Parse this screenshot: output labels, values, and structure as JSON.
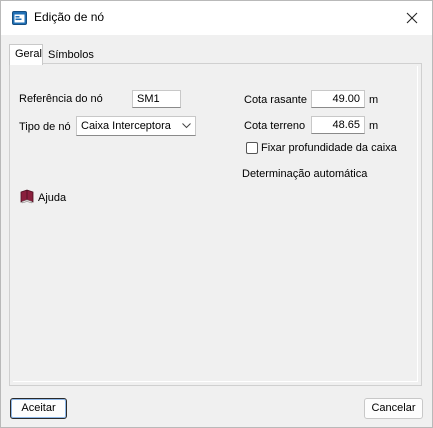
{
  "window": {
    "title": "Edição de nó",
    "icon": "window-app-icon",
    "close_icon": "close-icon"
  },
  "tabs": [
    {
      "label": "Geral",
      "active": true
    },
    {
      "label": "Símbolos",
      "active": false
    }
  ],
  "form": {
    "ref_label": "Referência do nó",
    "ref_value": "SM1",
    "type_label": "Tipo de nó",
    "type_value": "Caixa Interceptora",
    "cota_rasante_label": "Cota rasante",
    "cota_rasante_value": "49.00",
    "cota_rasante_unit": "m",
    "cota_terreno_label": "Cota terreno",
    "cota_terreno_value": "48.65",
    "cota_terreno_unit": "m",
    "fixar_label": "Fixar profundidade da caixa",
    "fixar_checked": false,
    "auto_label": "Determinação automática"
  },
  "help": {
    "label": "Ajuda",
    "icon": "book-help-icon"
  },
  "buttons": {
    "accept_label": "Aceitar",
    "cancel_label": "Cancelar"
  }
}
